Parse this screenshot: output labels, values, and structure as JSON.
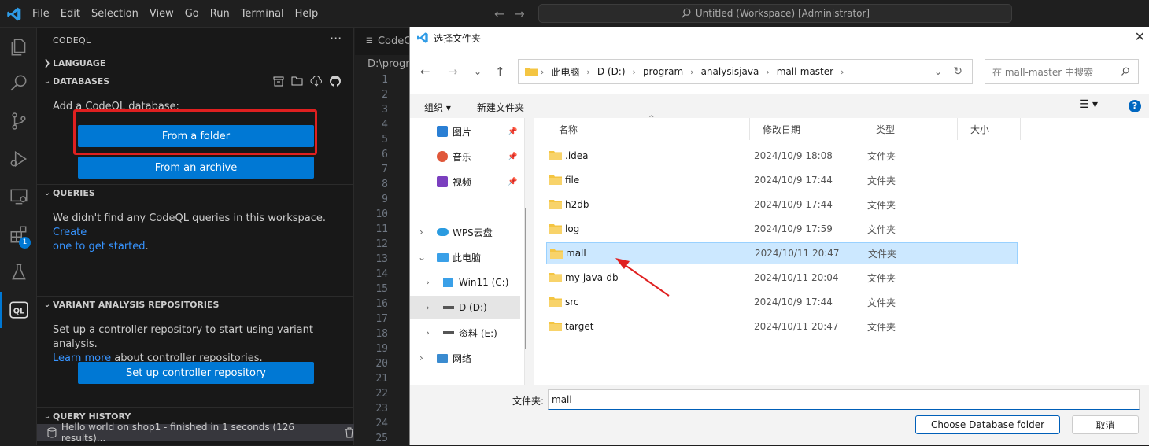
{
  "menu": [
    "File",
    "Edit",
    "Selection",
    "View",
    "Go",
    "Run",
    "Terminal",
    "Help"
  ],
  "command_center": "Untitled (Workspace) [Administrator]",
  "badge_count": "1",
  "sidebar": {
    "title": "CODEQL",
    "sections": {
      "language": "LANGUAGE",
      "databases": "DATABASES",
      "queries": "QUERIES",
      "variant": "VARIANT ANALYSIS REPOSITORIES",
      "history": "QUERY HISTORY"
    },
    "add_db_text": "Add a CodeQL database:",
    "from_folder": "From a folder",
    "from_archive": "From an archive",
    "queries_text": "We didn't find any CodeQL queries in this workspace. ",
    "queries_link1": "Create",
    "queries_link2": "one to get started",
    "queries_end": ".",
    "variant_text": "Set up a controller repository to start using variant analysis.",
    "variant_link": "Learn more",
    "variant_text2": " about controller repositories.",
    "setup_btn": "Set up controller repository",
    "history_item": "Hello world on shop1 - finished in 1 seconds (126 results)..."
  },
  "editor": {
    "tab": "CodeC",
    "breadcrumb": "D:\\progra",
    "line_numbers": [
      "1",
      "2",
      "3",
      "4",
      "5",
      "6",
      "7",
      "8",
      "9",
      "10",
      "11",
      "12",
      "13",
      "14",
      "15",
      "16",
      "17",
      "18",
      "19",
      "20",
      "21",
      "22",
      "23",
      "24",
      "25"
    ]
  },
  "dialog": {
    "title": "选择文件夹",
    "path": [
      "此电脑",
      "D (D:)",
      "program",
      "analysisjava",
      "mall-master"
    ],
    "search_placeholder": "在 mall-master 中搜索",
    "organize": "组织 ▾",
    "new_folder": "新建文件夹",
    "nav_items": [
      {
        "label": "图片"
      },
      {
        "label": "音乐"
      },
      {
        "label": "视频"
      },
      {
        "label": "WPS云盘"
      },
      {
        "label": "此电脑"
      },
      {
        "label": "Win11 (C:)"
      },
      {
        "label": "D (D:)"
      },
      {
        "label": "资料 (E:)"
      },
      {
        "label": "网络"
      }
    ],
    "columns": {
      "name": "名称",
      "date": "修改日期",
      "type": "类型",
      "size": "大小"
    },
    "files": [
      {
        "name": ".idea",
        "date": "2024/10/9 18:08",
        "type": "文件夹"
      },
      {
        "name": "file",
        "date": "2024/10/9 17:44",
        "type": "文件夹"
      },
      {
        "name": "h2db",
        "date": "2024/10/9 17:44",
        "type": "文件夹"
      },
      {
        "name": "log",
        "date": "2024/10/9 17:59",
        "type": "文件夹"
      },
      {
        "name": "mall",
        "date": "2024/10/11 20:47",
        "type": "文件夹"
      },
      {
        "name": "my-java-db",
        "date": "2024/10/11 20:04",
        "type": "文件夹"
      },
      {
        "name": "src",
        "date": "2024/10/9 17:44",
        "type": "文件夹"
      },
      {
        "name": "target",
        "date": "2024/10/11 20:47",
        "type": "文件夹"
      }
    ],
    "folder_label": "文件夹:",
    "folder_value": "mall",
    "choose_btn": "Choose Database folder",
    "cancel_btn": "取消"
  }
}
